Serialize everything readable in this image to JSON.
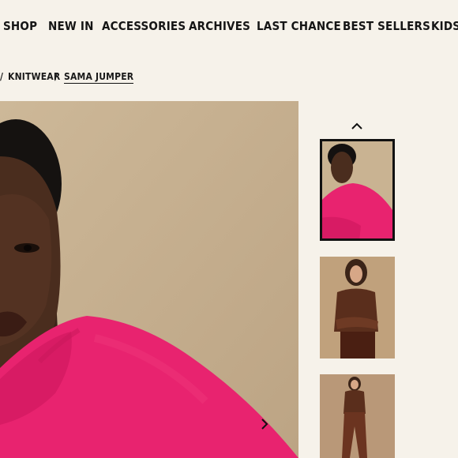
{
  "nav": {
    "items": [
      {
        "label": "SHOP"
      },
      {
        "label": "NEW IN"
      },
      {
        "label": "ACCESSORIES"
      },
      {
        "label": "ARCHIVES"
      },
      {
        "label": "LAST CHANCE"
      },
      {
        "label": "BEST SELLERS"
      },
      {
        "label": "KIDS"
      }
    ]
  },
  "breadcrumb": {
    "separator": "/",
    "items": [
      {
        "label": "KNITWEAR"
      },
      {
        "label": "SAMA JUMPER"
      }
    ]
  },
  "gallery": {
    "main_image": "model-pink-jumper-portrait",
    "next_icon": "chevron-right-icon",
    "prev_icon": "chevron-up-icon",
    "thumbnails": [
      {
        "name": "model-pink-jumper",
        "active": true
      },
      {
        "name": "model-brown-jumper-crossed-arms",
        "active": false
      },
      {
        "name": "model-brown-jumper-full-length",
        "active": false
      }
    ]
  },
  "colors": {
    "background": "#f6f2ea",
    "jumper_pink": "#e8236f",
    "backdrop": "#c7b293",
    "outfit_brown": "#6b3420"
  }
}
